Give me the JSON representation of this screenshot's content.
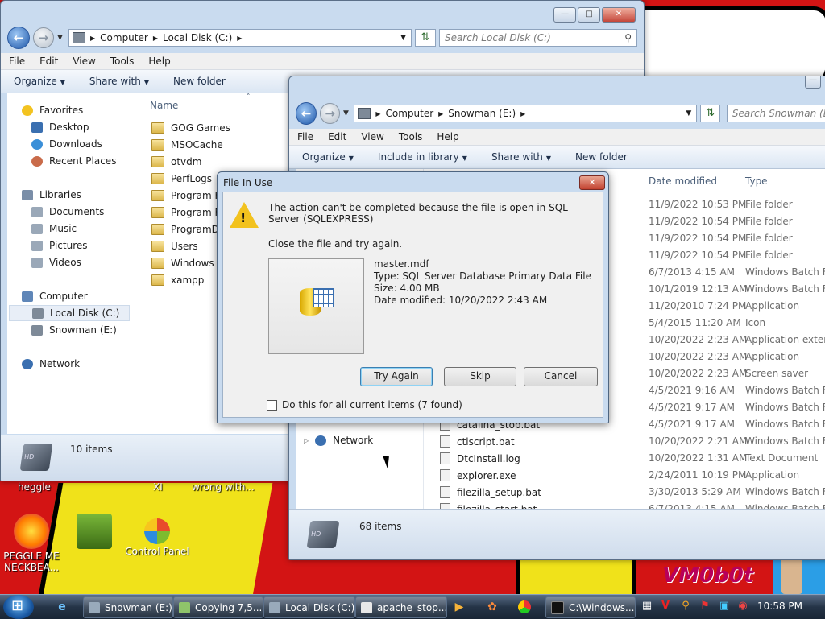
{
  "desktop": {
    "wallpaper_text": "",
    "wallpaper_tag": "VM0b0t",
    "partial_labels": [
      "heggle",
      "XI",
      "wrong with..."
    ],
    "icons": [
      {
        "label": "PEGGLE ME NECKBEA...",
        "icon": "peggle-icon"
      },
      {
        "label": "",
        "icon": "box-icon"
      },
      {
        "label": "Control Panel",
        "icon": "control-panel-icon"
      }
    ]
  },
  "explorer_local": {
    "address": [
      "Computer",
      "Local Disk (C:)"
    ],
    "search_placeholder": "Search Local Disk (C:)",
    "menu": [
      "File",
      "Edit",
      "View",
      "Tools",
      "Help"
    ],
    "commands": [
      {
        "label": "Organize",
        "dropdown": true
      },
      {
        "label": "Share with",
        "dropdown": true
      },
      {
        "label": "New folder",
        "dropdown": false
      }
    ],
    "nav": {
      "favorites": {
        "label": "Favorites",
        "items": [
          "Desktop",
          "Downloads",
          "Recent Places"
        ]
      },
      "libraries": {
        "label": "Libraries",
        "items": [
          "Documents",
          "Music",
          "Pictures",
          "Videos"
        ]
      },
      "computer": {
        "label": "Computer",
        "items": [
          "Local Disk (C:)",
          "Snowman (E:)"
        ]
      },
      "network": "Network"
    },
    "column_name": "Name",
    "folders": [
      "GOG Games",
      "MSOCache",
      "otvdm",
      "PerfLogs",
      "Program Files",
      "Program Files",
      "ProgramData",
      "Users",
      "Windows",
      "xampp"
    ],
    "status": "10 items"
  },
  "explorer_snowman": {
    "address": [
      "Computer",
      "Snowman (E:)"
    ],
    "search_placeholder": "Search Snowman (E:)",
    "menu": [
      "File",
      "Edit",
      "View",
      "Tools",
      "Help"
    ],
    "commands": [
      {
        "label": "Organize",
        "dropdown": true
      },
      {
        "label": "Include in library",
        "dropdown": true
      },
      {
        "label": "Share with",
        "dropdown": true
      },
      {
        "label": "New folder",
        "dropdown": false
      }
    ],
    "columns": {
      "date": "Date modified",
      "type": "Type"
    },
    "nav_network": "Network",
    "rows": [
      {
        "name": "",
        "date": "11/9/2022 10:53 PM",
        "type": "File folder"
      },
      {
        "name": "",
        "date": "11/9/2022 10:54 PM",
        "type": "File folder"
      },
      {
        "name": "",
        "date": "11/9/2022 10:54 PM",
        "type": "File folder"
      },
      {
        "name": "",
        "date": "11/9/2022 10:54 PM",
        "type": "File folder"
      },
      {
        "name": "",
        "date": "6/7/2013 4:15 AM",
        "type": "Windows Batch File"
      },
      {
        "name": "",
        "date": "10/1/2019 12:13 AM",
        "type": "Windows Batch File"
      },
      {
        "name": "",
        "date": "11/20/2010 7:24 PM",
        "type": "Application"
      },
      {
        "name": "",
        "date": "5/4/2015 11:20 AM",
        "type": "Icon"
      },
      {
        "name": "",
        "date": "10/20/2022 2:23 AM",
        "type": "Application extension"
      },
      {
        "name": "",
        "date": "10/20/2022 2:23 AM",
        "type": "Application"
      },
      {
        "name": "",
        "date": "10/20/2022 2:23 AM",
        "type": "Screen saver"
      },
      {
        "name": "",
        "date": "4/5/2021 9:16 AM",
        "type": "Windows Batch File"
      },
      {
        "name": "",
        "date": "4/5/2021 9:17 AM",
        "type": "Windows Batch File"
      },
      {
        "name": "catalina_stop.bat",
        "date": "4/5/2021 9:17 AM",
        "type": "Windows Batch File"
      },
      {
        "name": "ctlscript.bat",
        "date": "10/20/2022 2:21 AM",
        "type": "Windows Batch File"
      },
      {
        "name": "DtcInstall.log",
        "date": "10/20/2022 1:31 AM",
        "type": "Text Document"
      },
      {
        "name": "explorer.exe",
        "date": "2/24/2011 10:19 PM",
        "type": "Application"
      },
      {
        "name": "filezilla_setup.bat",
        "date": "3/30/2013 5:29 AM",
        "type": "Windows Batch File"
      },
      {
        "name": "filezilla_start.bat",
        "date": "6/7/2013 4:15 AM",
        "type": "Windows Batch File"
      }
    ],
    "status": "68 items"
  },
  "dialog": {
    "title": "File In Use",
    "message": "The action can't be completed because the file is open in SQL Server (SQLEXPRESS)",
    "sub": "Close the file and try again.",
    "file": {
      "name": "master.mdf",
      "type": "Type: SQL Server Database Primary Data File",
      "size": "Size: 4.00 MB",
      "modified": "Date modified: 10/20/2022 2:43 AM"
    },
    "buttons": {
      "try_again": "Try Again",
      "skip": "Skip",
      "cancel": "Cancel"
    },
    "checkbox": "Do this for all current items (7 found)"
  },
  "taskbar": {
    "buttons": [
      "Snowman (E:)",
      "Copying 7,5...",
      "Local Disk (C:)",
      "apache_stop...",
      "C:\\Windows..."
    ],
    "clock": "10:58 PM"
  }
}
